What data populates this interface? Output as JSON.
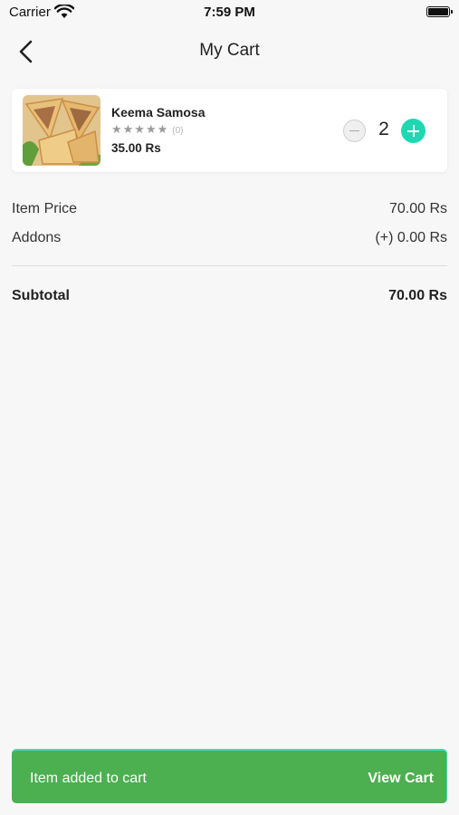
{
  "status_bar": {
    "carrier": "Carrier",
    "time": "7:59 PM"
  },
  "nav": {
    "title": "My Cart"
  },
  "cart": {
    "items": [
      {
        "name": "Keema Samosa",
        "stars": "★★★★★",
        "rating_count": "(0)",
        "price": "35.00 Rs",
        "quantity": "2"
      }
    ]
  },
  "summary": {
    "item_price_label": "Item Price",
    "item_price_value": "70.00 Rs",
    "addons_label": "Addons",
    "addons_value": "(+) 0.00 Rs",
    "subtotal_label": "Subtotal",
    "subtotal_value": "70.00 Rs"
  },
  "toast": {
    "message": "Item added to cart",
    "action": "View Cart"
  },
  "colors": {
    "accent": "#1ed8b2",
    "toast_bg": "#4caf50",
    "background": "#f7f7f7"
  }
}
